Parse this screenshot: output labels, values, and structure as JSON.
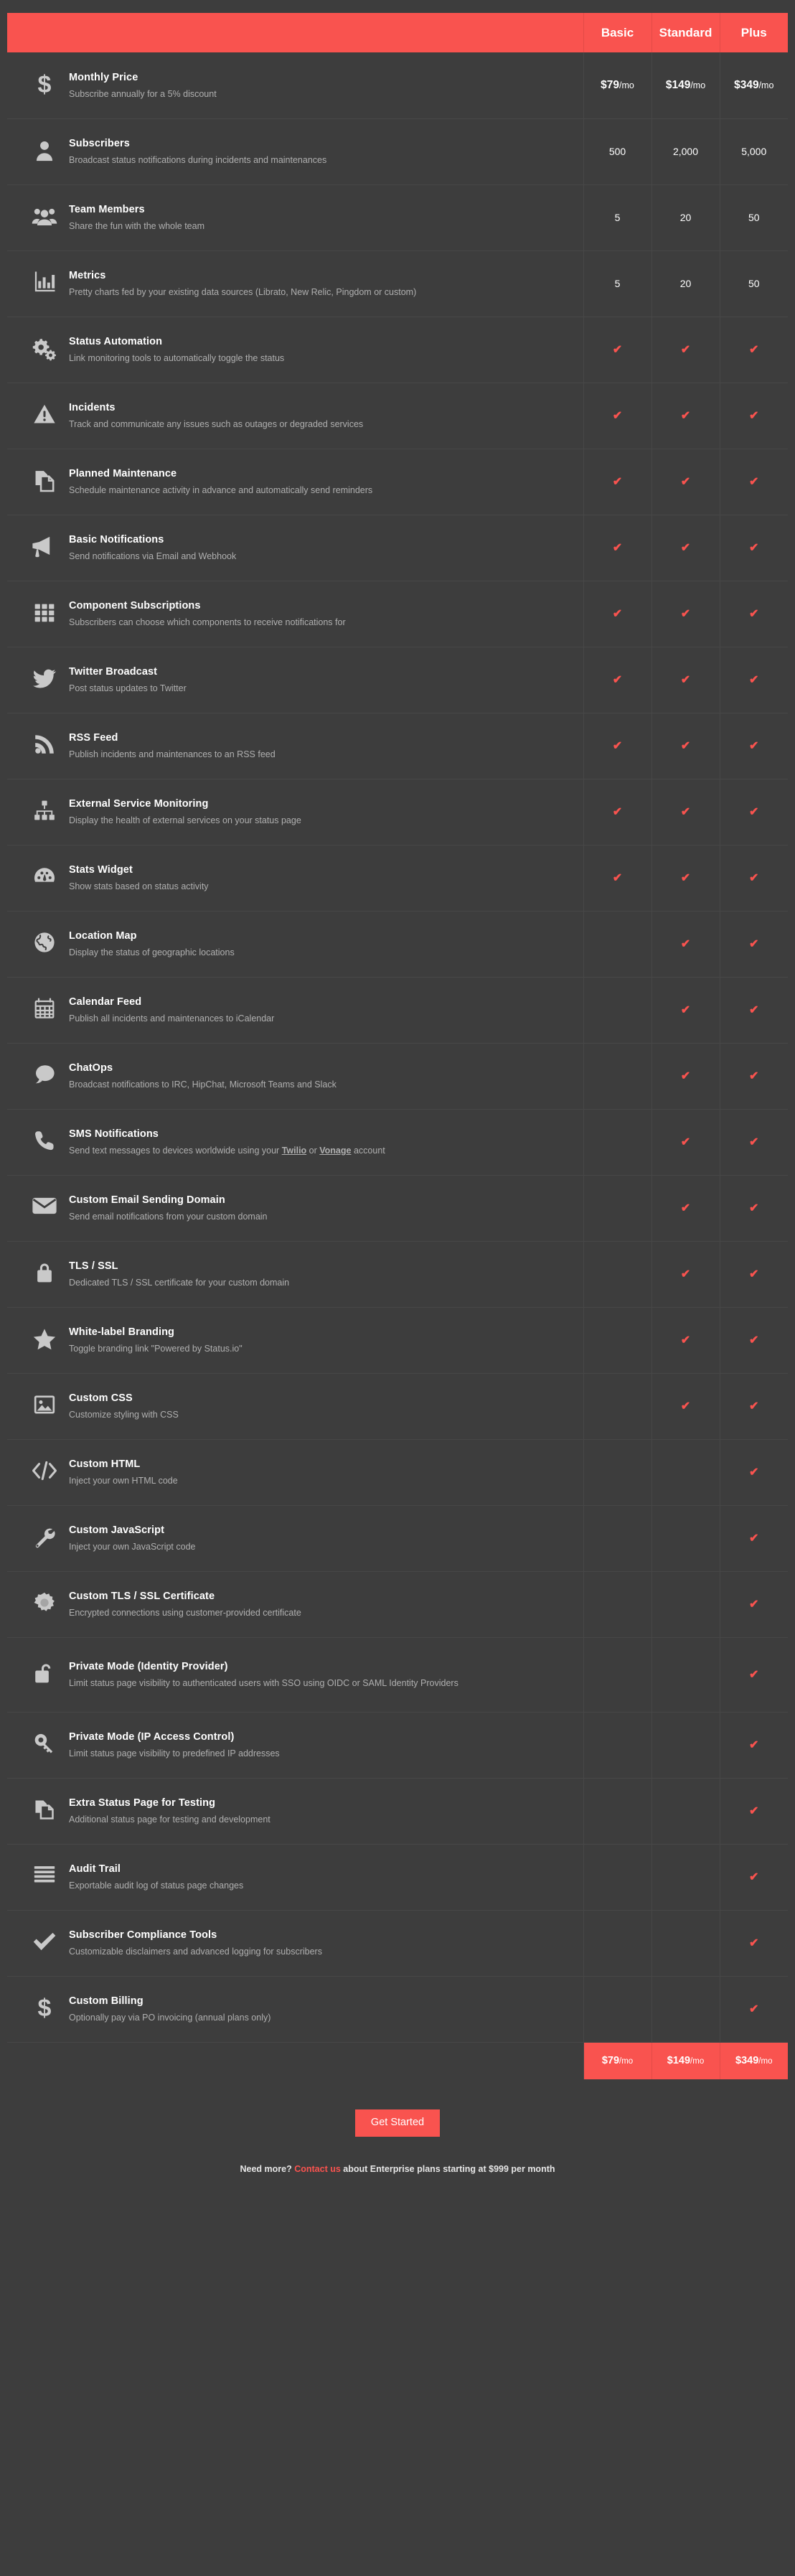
{
  "accent_color": "#f9534f",
  "background_color": "#3d3d3d",
  "row_divider_color": "#474747",
  "header": {
    "blank_label": "",
    "plans": [
      {
        "name": "Basic"
      },
      {
        "name": "Standard"
      },
      {
        "name": "Plus"
      }
    ]
  },
  "checkmark_glyph": "✔",
  "rows": [
    {
      "icon": "dollar-sign-icon",
      "title": "Monthly Price",
      "desc": "Subscribe annually for a 5% discount",
      "cells": [
        {
          "type": "price",
          "amount": "$79",
          "suffix": "/mo"
        },
        {
          "type": "price",
          "amount": "$149",
          "suffix": "/mo"
        },
        {
          "type": "price",
          "amount": "$349",
          "suffix": "/mo"
        }
      ]
    },
    {
      "icon": "user-icon",
      "title": "Subscribers",
      "desc": "Broadcast status notifications during incidents and maintenances",
      "cells": [
        {
          "type": "value",
          "text": "500"
        },
        {
          "type": "value",
          "text": "2,000"
        },
        {
          "type": "value",
          "text": "5,000"
        }
      ]
    },
    {
      "icon": "users-group-icon",
      "title": "Team Members",
      "desc": "Share the fun with the whole team",
      "cells": [
        {
          "type": "value",
          "text": "5"
        },
        {
          "type": "value",
          "text": "20"
        },
        {
          "type": "value",
          "text": "50"
        }
      ]
    },
    {
      "icon": "bar-chart-icon",
      "title": "Metrics",
      "desc": "Pretty charts fed by your existing data sources (Librato, New Relic, Pingdom or custom)",
      "cells": [
        {
          "type": "value",
          "text": "5"
        },
        {
          "type": "value",
          "text": "20"
        },
        {
          "type": "value",
          "text": "50"
        }
      ]
    },
    {
      "icon": "gears-icon",
      "title": "Status Automation",
      "desc": "Link monitoring tools to automatically toggle the status",
      "cells": [
        {
          "type": "check"
        },
        {
          "type": "check"
        },
        {
          "type": "check"
        }
      ]
    },
    {
      "icon": "warning-triangle-icon",
      "title": "Incidents",
      "desc": "Track and communicate any issues such as outages or degraded services",
      "cells": [
        {
          "type": "check"
        },
        {
          "type": "check"
        },
        {
          "type": "check"
        }
      ]
    },
    {
      "icon": "documents-copy-icon",
      "title": "Planned Maintenance",
      "desc": "Schedule maintenance activity in advance and automatically send reminders",
      "cells": [
        {
          "type": "check"
        },
        {
          "type": "check"
        },
        {
          "type": "check"
        }
      ]
    },
    {
      "icon": "megaphone-icon",
      "title": "Basic Notifications",
      "desc": "Send notifications via Email and Webhook",
      "cells": [
        {
          "type": "check"
        },
        {
          "type": "check"
        },
        {
          "type": "check"
        }
      ]
    },
    {
      "icon": "grid-icon",
      "title": "Component Subscriptions",
      "desc": "Subscribers can choose which components to receive notifications for",
      "cells": [
        {
          "type": "check"
        },
        {
          "type": "check"
        },
        {
          "type": "check"
        }
      ]
    },
    {
      "icon": "twitter-bird-icon",
      "title": "Twitter Broadcast",
      "desc": "Post status updates to Twitter",
      "cells": [
        {
          "type": "check"
        },
        {
          "type": "check"
        },
        {
          "type": "check"
        }
      ]
    },
    {
      "icon": "rss-feed-icon",
      "title": "RSS Feed",
      "desc": "Publish incidents and maintenances to an RSS feed",
      "cells": [
        {
          "type": "check"
        },
        {
          "type": "check"
        },
        {
          "type": "check"
        }
      ]
    },
    {
      "icon": "sitemap-icon",
      "title": "External Service Monitoring",
      "desc": "Display the health of external services on your status page",
      "cells": [
        {
          "type": "check"
        },
        {
          "type": "check"
        },
        {
          "type": "check"
        }
      ]
    },
    {
      "icon": "dashboard-gauge-icon",
      "title": "Stats Widget",
      "desc": "Show stats based on status activity",
      "cells": [
        {
          "type": "check"
        },
        {
          "type": "check"
        },
        {
          "type": "check"
        }
      ]
    },
    {
      "icon": "globe-icon",
      "title": "Location Map",
      "desc": "Display the status of geographic locations",
      "cells": [
        {
          "type": "empty"
        },
        {
          "type": "check"
        },
        {
          "type": "check"
        }
      ]
    },
    {
      "icon": "calendar-icon",
      "title": "Calendar Feed",
      "desc": "Publish all incidents and maintenances to iCalendar",
      "cells": [
        {
          "type": "empty"
        },
        {
          "type": "check"
        },
        {
          "type": "check"
        }
      ]
    },
    {
      "icon": "chat-bubble-icon",
      "title": "ChatOps",
      "desc": "Broadcast notifications to IRC, HipChat, Microsoft Teams and Slack",
      "cells": [
        {
          "type": "empty"
        },
        {
          "type": "check"
        },
        {
          "type": "check"
        }
      ]
    },
    {
      "icon": "phone-icon",
      "title": "SMS Notifications",
      "desc_parts": [
        {
          "text": "Send text messages to devices worldwide using your ",
          "link": false
        },
        {
          "text": "Twilio",
          "link": true
        },
        {
          "text": " or ",
          "link": false
        },
        {
          "text": "Vonage",
          "link": true
        },
        {
          "text": " account",
          "link": false
        }
      ],
      "desc": "Send text messages to devices worldwide using your Twilio or Vonage account",
      "cells": [
        {
          "type": "empty"
        },
        {
          "type": "check"
        },
        {
          "type": "check"
        }
      ]
    },
    {
      "icon": "envelope-icon",
      "title": "Custom Email Sending Domain",
      "desc": "Send email notifications from your custom domain",
      "cells": [
        {
          "type": "empty"
        },
        {
          "type": "check"
        },
        {
          "type": "check"
        }
      ]
    },
    {
      "icon": "lock-closed-icon",
      "title": "TLS / SSL",
      "desc": "Dedicated TLS / SSL certificate for your custom domain",
      "cells": [
        {
          "type": "empty"
        },
        {
          "type": "check"
        },
        {
          "type": "check"
        }
      ]
    },
    {
      "icon": "star-icon",
      "title": "White-label Branding",
      "desc": "Toggle branding link \"Powered by Status.io\"",
      "cells": [
        {
          "type": "empty"
        },
        {
          "type": "check"
        },
        {
          "type": "check"
        }
      ]
    },
    {
      "icon": "image-picture-icon",
      "title": "Custom CSS",
      "desc": "Customize styling with CSS",
      "cells": [
        {
          "type": "empty"
        },
        {
          "type": "check"
        },
        {
          "type": "check"
        }
      ]
    },
    {
      "icon": "code-brackets-icon",
      "title": "Custom HTML",
      "desc": "Inject your own HTML code",
      "cells": [
        {
          "type": "empty"
        },
        {
          "type": "empty"
        },
        {
          "type": "check"
        }
      ]
    },
    {
      "icon": "wrench-icon",
      "title": "Custom JavaScript",
      "desc": "Inject your own JavaScript code",
      "cells": [
        {
          "type": "empty"
        },
        {
          "type": "empty"
        },
        {
          "type": "check"
        }
      ]
    },
    {
      "icon": "certificate-badge-icon",
      "title": "Custom TLS / SSL Certificate",
      "desc": "Encrypted connections using customer-provided certificate",
      "cells": [
        {
          "type": "empty"
        },
        {
          "type": "empty"
        },
        {
          "type": "check"
        }
      ]
    },
    {
      "icon": "lock-open-icon",
      "title": "Private Mode (Identity Provider)",
      "desc": "Limit status page visibility to authenticated users with SSO using OIDC or SAML Identity Providers",
      "cells": [
        {
          "type": "empty"
        },
        {
          "type": "empty"
        },
        {
          "type": "check"
        }
      ]
    },
    {
      "icon": "key-icon",
      "title": "Private Mode (IP Access Control)",
      "desc": "Limit status page visibility to predefined IP addresses",
      "cells": [
        {
          "type": "empty"
        },
        {
          "type": "empty"
        },
        {
          "type": "check"
        }
      ]
    },
    {
      "icon": "copy-pages-icon",
      "title": "Extra Status Page for Testing",
      "desc": "Additional status page for testing and development",
      "cells": [
        {
          "type": "empty"
        },
        {
          "type": "empty"
        },
        {
          "type": "check"
        }
      ]
    },
    {
      "icon": "list-lines-icon",
      "title": "Audit Trail",
      "desc": "Exportable audit log of status page changes",
      "cells": [
        {
          "type": "empty"
        },
        {
          "type": "empty"
        },
        {
          "type": "check"
        }
      ]
    },
    {
      "icon": "checkmark-icon",
      "title": "Subscriber Compliance Tools",
      "desc": "Customizable disclaimers and advanced logging for subscribers",
      "cells": [
        {
          "type": "empty"
        },
        {
          "type": "empty"
        },
        {
          "type": "check"
        }
      ]
    },
    {
      "icon": "dollar-sign-icon",
      "title": "Custom Billing",
      "desc": "Optionally pay via PO invoicing (annual plans only)",
      "cells": [
        {
          "type": "empty"
        },
        {
          "type": "empty"
        },
        {
          "type": "check"
        }
      ]
    }
  ],
  "footer_prices": [
    {
      "amount": "$79",
      "suffix": "/mo"
    },
    {
      "amount": "$149",
      "suffix": "/mo"
    },
    {
      "amount": "$349",
      "suffix": "/mo"
    }
  ],
  "cta": {
    "get_started_label": "Get Started",
    "need_more_prefix": "Need more?",
    "contact_link": "Contact us",
    "need_more_suffix": "about Enterprise plans starting at $999 per month"
  }
}
